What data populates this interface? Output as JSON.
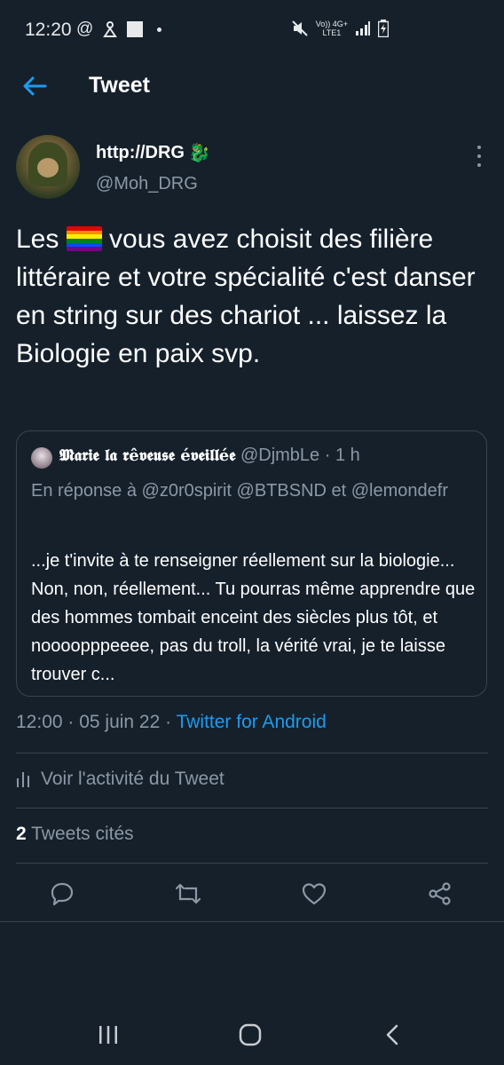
{
  "status_bar": {
    "time": "12:20",
    "left_icons": [
      "at-icon",
      "notification-icon",
      "image-icon",
      "dot-icon"
    ],
    "network_top": "Vo)) 4G+",
    "network_bottom": "LTE1"
  },
  "header": {
    "title": "Tweet"
  },
  "author": {
    "display_name": "http://DRG",
    "name_emoji": "🐉",
    "handle": "@Moh_DRG"
  },
  "tweet": {
    "text_before_flag": "Les ",
    "text_after_flag": " vous avez choisit des filière littéraire et votre spécialité c'est danser en string sur des chariot ... laissez la Biologie en paix svp.",
    "flag_colors": [
      "#e40303",
      "#ff8c00",
      "#ffed00",
      "#008026",
      "#004dff",
      "#750787"
    ]
  },
  "quoted_tweet": {
    "name": "𝕸𝖆𝖗𝖎𝖊 𝖑𝖆 𝖗ê𝖛𝖊𝖚𝖘𝖊 é𝖛𝖊𝖎𝖑𝖑é𝖊",
    "handle_time": "@DjmbLe · 1 h",
    "reply_to": "En réponse à @z0r0spirit @BTBSND et @lemondefr",
    "body": "...je t'invite à te renseigner réellement sur la biologie... Non, non, réellement... Tu pourras même apprendre que des hommes tombait enceint des siècles plus tôt, et noooopppeeee, pas du troll, la vérité vrai, je te laisse trouver c..."
  },
  "meta": {
    "time_date": "12:00 · 05 juin 22 · ",
    "source": "Twitter for Android"
  },
  "activity": {
    "label": "Voir l'activité du Tweet"
  },
  "quotes": {
    "count": "2",
    "label": " Tweets cités"
  },
  "colors": {
    "background": "#15202b",
    "accent": "#1d9bf0",
    "secondary_text": "#8b98a5",
    "border": "#38444d"
  }
}
